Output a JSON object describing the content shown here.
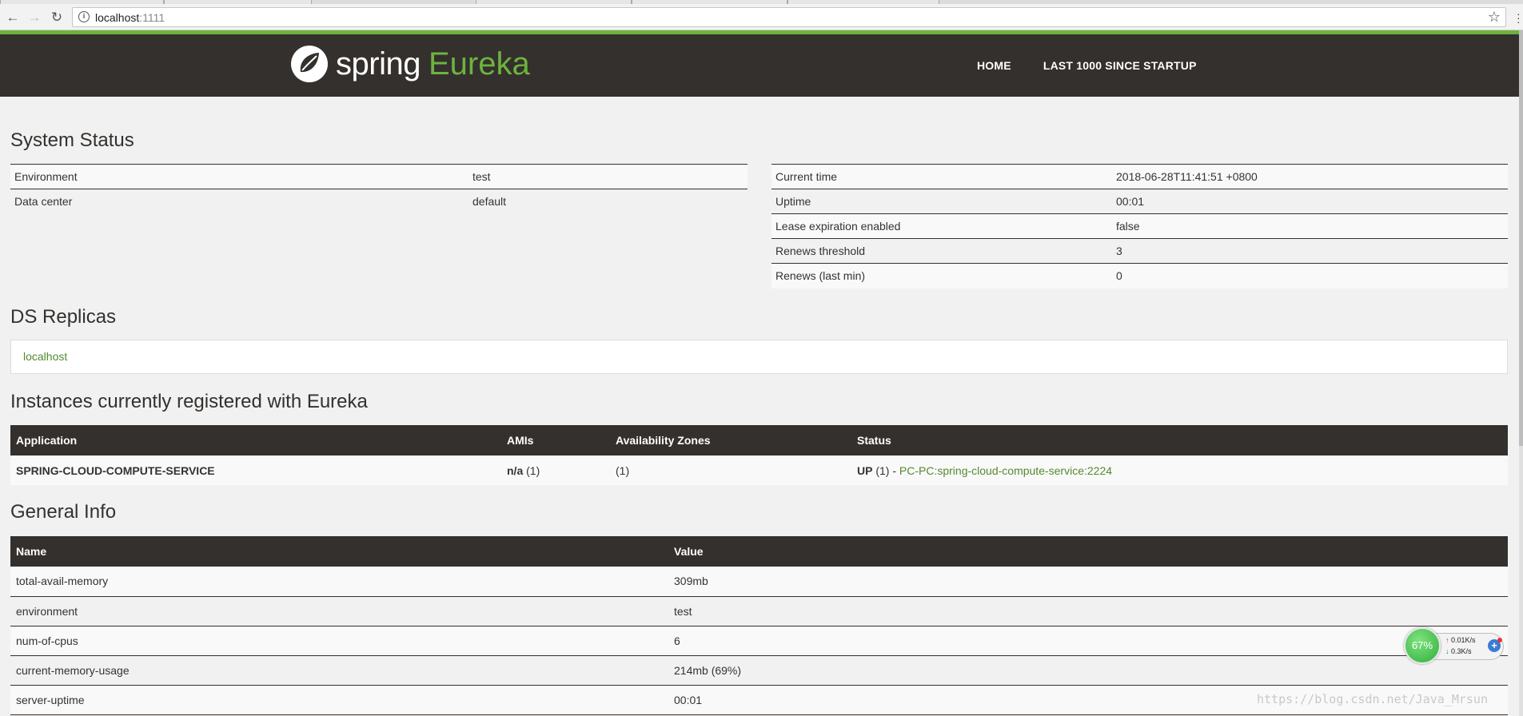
{
  "browser": {
    "url_host": "localhost",
    "url_port": ":1111"
  },
  "header": {
    "logo_word": "spring",
    "logo_product": "Eureka",
    "nav": [
      {
        "label": "HOME"
      },
      {
        "label": "LAST 1000 SINCE STARTUP"
      }
    ]
  },
  "system_status": {
    "title": "System Status",
    "left": [
      {
        "key": "Environment",
        "value": "test"
      },
      {
        "key": "Data center",
        "value": "default"
      }
    ],
    "right": [
      {
        "key": "Current time",
        "value": "2018-06-28T11:41:51 +0800"
      },
      {
        "key": "Uptime",
        "value": "00:01"
      },
      {
        "key": "Lease expiration enabled",
        "value": "false"
      },
      {
        "key": "Renews threshold",
        "value": "3"
      },
      {
        "key": "Renews (last min)",
        "value": "0"
      }
    ]
  },
  "replicas": {
    "title": "DS Replicas",
    "link": "localhost"
  },
  "instances": {
    "title": "Instances currently registered with Eureka",
    "headers": [
      "Application",
      "AMIs",
      "Availability Zones",
      "Status"
    ],
    "row": {
      "application": "SPRING-CLOUD-COMPUTE-SERVICE",
      "amis_bold": "n/a",
      "amis_count": " (1)",
      "zones": "(1)",
      "status_bold": "UP",
      "status_count": " (1) - ",
      "status_link": "PC-PC:spring-cloud-compute-service:2224"
    }
  },
  "general_info": {
    "title": "General Info",
    "headers": [
      "Name",
      "Value"
    ],
    "rows": [
      {
        "name": "total-avail-memory",
        "value": "309mb"
      },
      {
        "name": "environment",
        "value": "test"
      },
      {
        "name": "num-of-cpus",
        "value": "6"
      },
      {
        "name": "current-memory-usage",
        "value": "214mb (69%)"
      },
      {
        "name": "server-uptime",
        "value": "00:01"
      }
    ]
  },
  "net_widget": {
    "percent": "67%",
    "up_rate": "0.01K/s",
    "down_rate": "0.3K/s",
    "up_arrow": "↑",
    "down_arrow": "↓"
  },
  "watermark": "https://blog.csdn.net/Java_Mrsun"
}
